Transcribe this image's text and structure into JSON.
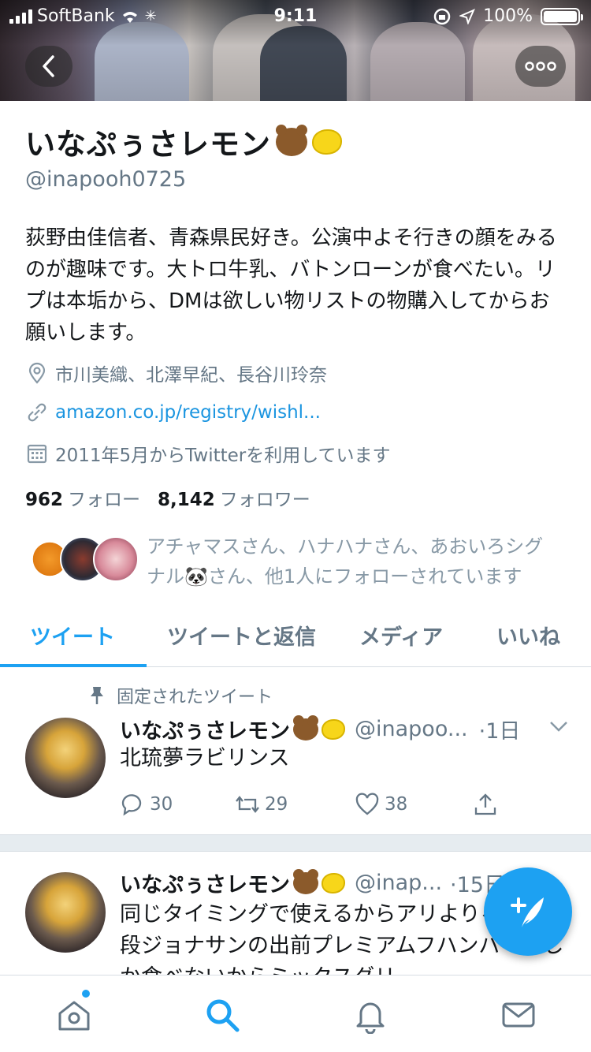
{
  "status_bar": {
    "carrier": "SoftBank",
    "time": "9:11",
    "battery": "100%"
  },
  "profile": {
    "name": "いなぷぅさレモン",
    "handle": "@inapooh0725",
    "bio": "荻野由佳信者、青森県民好き。公演中よそ行きの顔をみるのが趣味です。大トロ牛乳、バトンローンが食べたい。リプは本垢から、DMは欲しい物リストの物購入してからお願いします。",
    "location": "市川美織、北澤早紀、長谷川玲奈",
    "website": "amazon.co.jp/registry/wishl...",
    "joined": "2011年5月からTwitterを利用しています",
    "following_count": "962",
    "following_label": "フォロー",
    "followers_count": "8,142",
    "followers_label": "フォロワー",
    "followed_by": "アチャマスさん、ハナハナさん、あおいろシグナル🐼さん、他1人にフォローされています"
  },
  "tabs": [
    {
      "label": "ツイート",
      "active": true
    },
    {
      "label": "ツイートと返信"
    },
    {
      "label": "メディア"
    },
    {
      "label": "いいね"
    }
  ],
  "tweets": [
    {
      "pinned_label": "固定されたツイート",
      "name": "いなぷぅさレモン",
      "handle": "@inapoo...",
      "time": "·1日",
      "text": "北琉夢ラビリンス",
      "replies": "30",
      "retweets": "29",
      "likes": "38"
    },
    {
      "name": "いなぷぅさレモン",
      "handle": "@inap...",
      "time": "·15日",
      "text": "同じタイミングで使えるからアリよりるけど普段ジョナサンの出前プレミアムフハンバーグしか食べないからミックスグリ"
    }
  ],
  "colors": {
    "accent": "#1da1f2",
    "secondary_text": "#657786",
    "link": "#1b95e0"
  },
  "icons": {
    "back": "chevron-left-icon",
    "more": "more-icon",
    "location": "location-pin-icon",
    "link": "link-icon",
    "calendar": "calendar-icon",
    "pin": "pin-icon",
    "reply": "reply-icon",
    "retweet": "retweet-icon",
    "like": "heart-icon",
    "share": "share-icon",
    "compose": "compose-icon",
    "home": "home-icon",
    "search": "search-icon",
    "notifications": "bell-icon",
    "messages": "mail-icon"
  }
}
